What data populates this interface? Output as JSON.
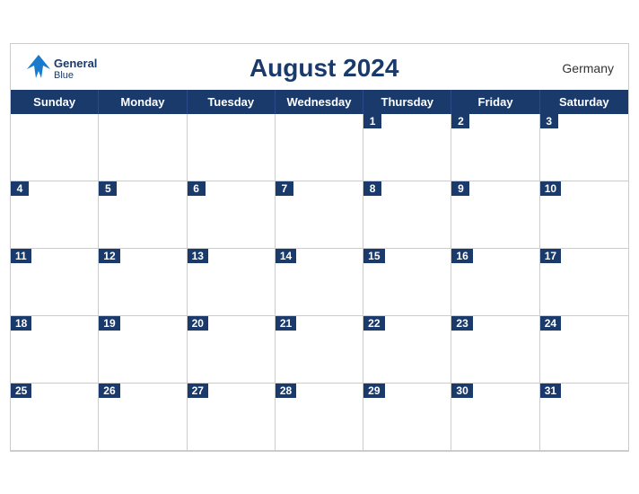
{
  "header": {
    "logo_general": "General",
    "logo_blue": "Blue",
    "month_title": "August 2024",
    "country": "Germany"
  },
  "days": [
    "Sunday",
    "Monday",
    "Tuesday",
    "Wednesday",
    "Thursday",
    "Friday",
    "Saturday"
  ],
  "weeks": [
    [
      null,
      null,
      null,
      null,
      1,
      2,
      3
    ],
    [
      4,
      5,
      6,
      7,
      8,
      9,
      10
    ],
    [
      11,
      12,
      13,
      14,
      15,
      16,
      17
    ],
    [
      18,
      19,
      20,
      21,
      22,
      23,
      24
    ],
    [
      25,
      26,
      27,
      28,
      29,
      30,
      31
    ]
  ]
}
